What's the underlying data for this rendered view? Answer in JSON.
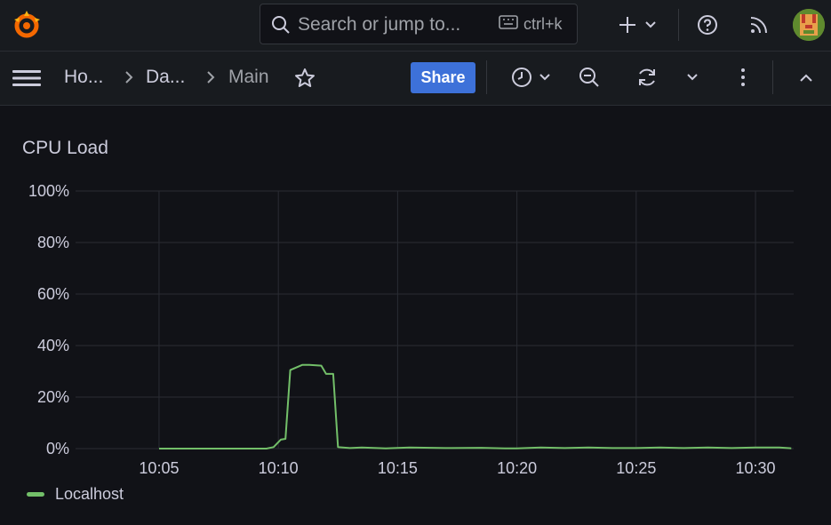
{
  "colors": {
    "accent": "#3d71d9",
    "series": "#73bf69",
    "grid": "#2a2c33",
    "logo": "#f46800"
  },
  "topbar": {
    "search_placeholder": "Search or jump to...",
    "shortcut": "ctrl+k",
    "icons": [
      "grafana-logo-icon",
      "search-icon",
      "keyboard-icon",
      "plus-icon",
      "help-icon",
      "rss-icon",
      "avatar"
    ]
  },
  "breadcrumbs": {
    "home": "Ho...",
    "dashboards": "Da...",
    "current": "Main"
  },
  "toolbar": {
    "share_label": "Share"
  },
  "panel": {
    "title": "CPU Load"
  },
  "chart_data": {
    "type": "line",
    "title": "CPU Load",
    "xlabel": "",
    "ylabel": "",
    "ylim": [
      0,
      100
    ],
    "y_ticks": [
      "0%",
      "20%",
      "40%",
      "60%",
      "80%",
      "100%"
    ],
    "x_ticks": [
      "10:05",
      "10:10",
      "10:15",
      "10:20",
      "10:25",
      "10:30"
    ],
    "x_tick_values": [
      5,
      10,
      15,
      20,
      25,
      30
    ],
    "xlim": [
      1.5,
      31.6
    ],
    "grid": true,
    "legend_position": "bottom-left",
    "series": [
      {
        "name": "Localhost",
        "color": "#73bf69",
        "x": [
          5.0,
          9.5,
          9.8,
          10.1,
          10.3,
          10.5,
          11.0,
          11.3,
          11.8,
          12.0,
          12.3,
          12.5,
          13.0,
          13.5,
          14.5,
          15.5,
          17.0,
          18.5,
          19.5,
          20.0,
          21.0,
          22.0,
          23.0,
          24.0,
          25.0,
          26.0,
          27.0,
          28.0,
          29.0,
          30.0,
          31.0,
          31.5
        ],
        "y": [
          0.0,
          0.0,
          0.6,
          3.5,
          3.8,
          30.5,
          32.5,
          32.5,
          32.2,
          29.0,
          29.0,
          0.6,
          0.2,
          0.4,
          0.1,
          0.4,
          0.2,
          0.3,
          0.1,
          0.1,
          0.4,
          0.2,
          0.4,
          0.2,
          0.2,
          0.4,
          0.2,
          0.4,
          0.2,
          0.4,
          0.4,
          0.1
        ]
      }
    ]
  }
}
